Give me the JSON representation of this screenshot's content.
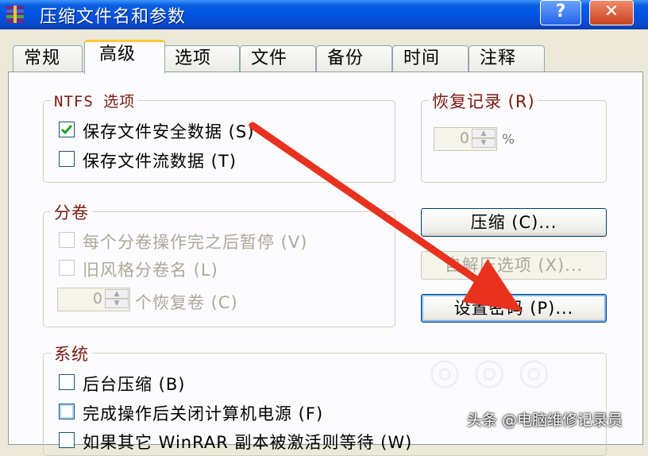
{
  "window": {
    "title": "压缩文件名和参数",
    "help_label": "?",
    "close_label": "✕"
  },
  "tabs": [
    {
      "label": "常规"
    },
    {
      "label": "高级"
    },
    {
      "label": "选项"
    },
    {
      "label": "文件"
    },
    {
      "label": "备份"
    },
    {
      "label": "时间"
    },
    {
      "label": "注释"
    }
  ],
  "active_tab": "高级",
  "ntfs": {
    "title": "NTFS 选项",
    "items": [
      {
        "label": "保存文件安全数据 (S)",
        "checked": true
      },
      {
        "label": "保存文件流数据 (T)",
        "checked": false
      }
    ]
  },
  "recovery": {
    "title": "恢复记录 (R)",
    "value": "0",
    "unit": "%"
  },
  "volumes": {
    "title": "分卷",
    "items": [
      {
        "label": "每个分卷操作完之后暂停 (V)",
        "checked": false
      },
      {
        "label": "旧风格分卷名 (L)",
        "checked": false
      }
    ],
    "spin_value": "0",
    "spin_label": "个恢复卷 (C)"
  },
  "buttons": {
    "compress": "压缩 (C)...",
    "self_extract": "自解压选项 (X)...",
    "set_password": "设置密码 (P)..."
  },
  "system": {
    "title": "系统",
    "items": [
      {
        "label": "后台压缩 (B)",
        "checked": false
      },
      {
        "label": "完成操作后关闭计算机电源 (F)",
        "checked": false
      },
      {
        "label": "如果其它 WinRAR 副本被激活则等待 (W)",
        "checked": false
      }
    ]
  },
  "watermark": "头条 @电脑维修记录员",
  "colors": {
    "titlebar": "#0054e3",
    "group_title": "#7a1a10",
    "arrow": "#e8321e"
  }
}
